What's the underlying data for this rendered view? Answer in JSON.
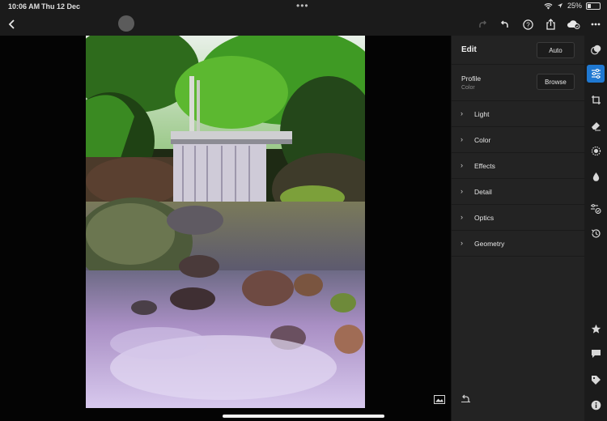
{
  "status_bar": {
    "time": "10:06 AM",
    "date": "Thu 12 Dec",
    "battery": "25%"
  },
  "toolbar": {
    "left": [
      {
        "icon": "back-chevron-icon"
      }
    ],
    "right": [
      {
        "icon": "redo-icon",
        "enabled": false
      },
      {
        "icon": "undo-icon",
        "enabled": true
      },
      {
        "icon": "help-icon",
        "enabled": true
      },
      {
        "icon": "share-icon",
        "enabled": true
      },
      {
        "icon": "cloud-sync-icon",
        "enabled": true
      },
      {
        "icon": "more-icon",
        "enabled": true
      }
    ]
  },
  "edit_panel": {
    "title": "Edit",
    "auto_label": "Auto",
    "profile": {
      "label": "Profile",
      "value": "Color",
      "browse_label": "Browse"
    },
    "sections": [
      {
        "label": "Light"
      },
      {
        "label": "Color"
      },
      {
        "label": "Effects"
      },
      {
        "label": "Detail"
      },
      {
        "label": "Optics"
      },
      {
        "label": "Geometry"
      }
    ]
  },
  "tool_rail": {
    "items": [
      {
        "icon": "presets-icon",
        "active": false
      },
      {
        "icon": "edit-sliders-icon",
        "active": true
      },
      {
        "icon": "crop-icon",
        "active": false
      },
      {
        "icon": "eraser-icon",
        "active": false
      },
      {
        "icon": "masking-icon",
        "active": false
      },
      {
        "icon": "blur-drop-icon",
        "active": false
      },
      {
        "icon": "versions-icon",
        "active": false
      },
      {
        "icon": "history-icon",
        "active": false
      },
      {
        "icon": "star-icon",
        "active": false
      },
      {
        "icon": "comment-icon",
        "active": false
      },
      {
        "icon": "tag-icon",
        "active": false
      },
      {
        "icon": "info-icon",
        "active": false
      }
    ]
  },
  "colors": {
    "accent": "#1f78d1",
    "panel_bg": "#232323",
    "toolbar_bg": "#1b1b1b"
  }
}
